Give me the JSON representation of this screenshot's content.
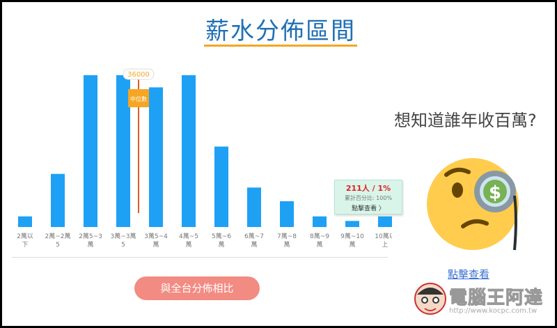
{
  "title": "薪水分佈區間",
  "chart_data": {
    "type": "bar",
    "categories": [
      "2萬以下",
      "2萬~2萬5",
      "2萬5~3萬",
      "3萬~3萬5",
      "3萬5~4萬",
      "4萬~5萬",
      "5萬~6萬",
      "6萬~7萬",
      "7萬~8萬",
      "8萬~9萬",
      "9萬~10萬",
      "10萬以上"
    ],
    "category_lines": [
      [
        "2萬以",
        "下"
      ],
      [
        "2萬~2萬",
        "5"
      ],
      [
        "2萬5~3",
        "萬"
      ],
      [
        "3萬~3萬",
        "5"
      ],
      [
        "3萬5~4",
        "萬"
      ],
      [
        "4萬~5",
        "萬"
      ],
      [
        "5萬~6",
        "萬"
      ],
      [
        "6萬~7",
        "萬"
      ],
      [
        "7萬~8",
        "萬"
      ],
      [
        "8萬~9",
        "萬"
      ],
      [
        "9萬~10",
        "萬"
      ],
      [
        "10萬以",
        "上"
      ]
    ],
    "values": [
      7,
      35,
      100,
      100,
      92,
      100,
      53,
      26,
      17,
      7,
      4,
      7
    ],
    "ylim": [
      0,
      100
    ],
    "bar_color": "#1ea0f5",
    "median": {
      "value": "36000",
      "label": "中位數",
      "line_color": "#e05a2a",
      "tag_color": "#f5a623"
    }
  },
  "tooltip": {
    "main": "211人 / 1%",
    "sub": "累計百分比: 100%",
    "link": "點擊查看 〉"
  },
  "compare_button": "與全台分佈相比",
  "promo": {
    "question": "想知道誰年收百萬?",
    "link": "點擊查看",
    "icon": "monocle-money-face-icon"
  },
  "watermark": {
    "name": "電腦王阿達",
    "url": "http://www.kocpc.com.tw"
  }
}
